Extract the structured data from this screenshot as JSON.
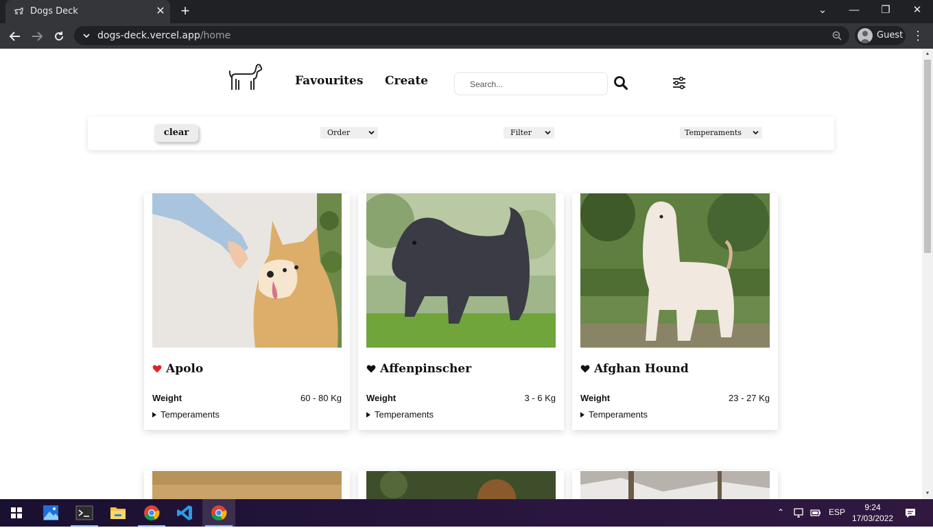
{
  "browser": {
    "tab_title": "Dogs Deck",
    "url_host": "dogs-deck.vercel.app",
    "url_path": "/home",
    "profile_label": "Guest"
  },
  "nav": {
    "links": [
      "Favourites",
      "Create"
    ],
    "search_placeholder": "Search..."
  },
  "filters": {
    "clear_label": "clear",
    "order_label": "Order",
    "filter_label": "Filter",
    "temperaments_label": "Temperaments"
  },
  "cards": [
    {
      "name": "Apolo",
      "weight_label": "Weight",
      "weight": "60 - 80 Kg",
      "temperaments_label": "Temperaments",
      "favourite": true,
      "heart_color": "#e02424"
    },
    {
      "name": "Affenpinscher",
      "weight_label": "Weight",
      "weight": "3 - 6 Kg",
      "temperaments_label": "Temperaments",
      "favourite": false,
      "heart_color": "#111111"
    },
    {
      "name": "Afghan Hound",
      "weight_label": "Weight",
      "weight": "23 - 27 Kg",
      "temperaments_label": "Temperaments",
      "favourite": false,
      "heart_color": "#111111"
    }
  ],
  "taskbar": {
    "language": "ESP",
    "time": "9:24",
    "date": "17/03/2022"
  }
}
